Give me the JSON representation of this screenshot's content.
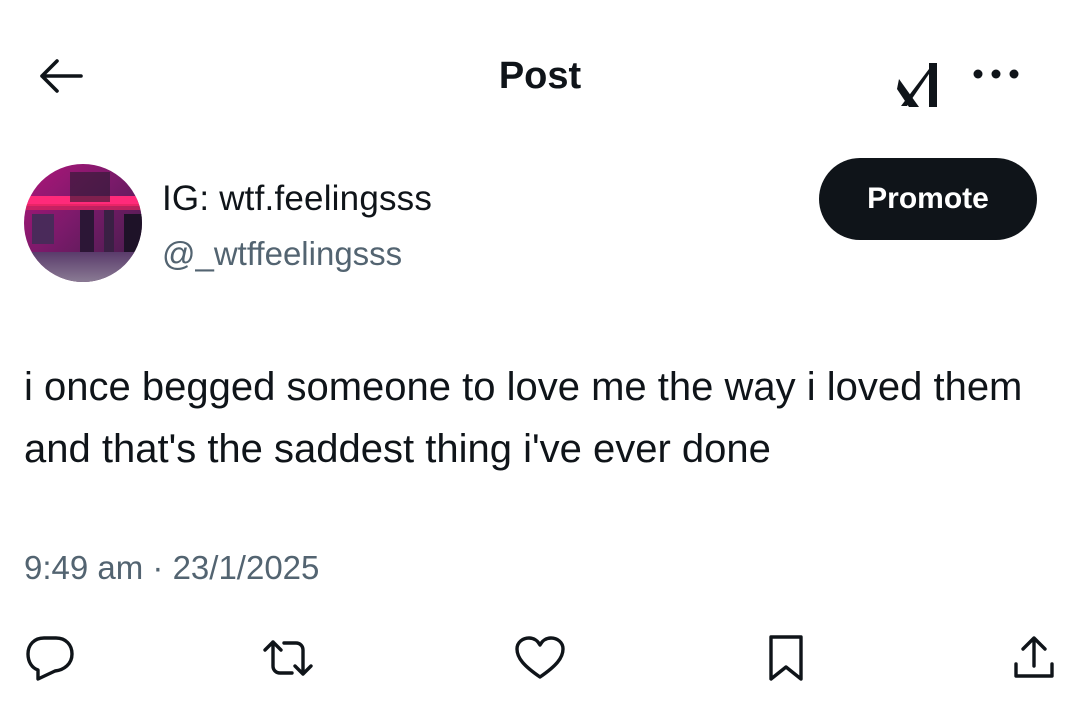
{
  "header": {
    "title": "Post",
    "back_icon": "arrow-left-icon",
    "grok_icon": "grok-icon",
    "more_icon": "more-horizontal-icon"
  },
  "author": {
    "display_name": "IG: wtf.feelingsss",
    "handle": "@_wtffeelingsss",
    "avatar": "profile-avatar"
  },
  "promote_label": "Promote",
  "post": {
    "text": "i once begged someone to love me the way i loved them and that's the saddest thing i've ever done",
    "timestamp": "9:49 am · 23/1/2025"
  },
  "actions": [
    {
      "name": "reply",
      "icon": "reply-icon"
    },
    {
      "name": "repost",
      "icon": "repost-icon"
    },
    {
      "name": "like",
      "icon": "heart-icon"
    },
    {
      "name": "bookmark",
      "icon": "bookmark-icon"
    },
    {
      "name": "share",
      "icon": "share-icon"
    }
  ],
  "colors": {
    "text_primary": "#0f1419",
    "text_secondary": "#536471",
    "button_bg": "#0f1419",
    "button_text": "#ffffff",
    "background": "#ffffff"
  }
}
